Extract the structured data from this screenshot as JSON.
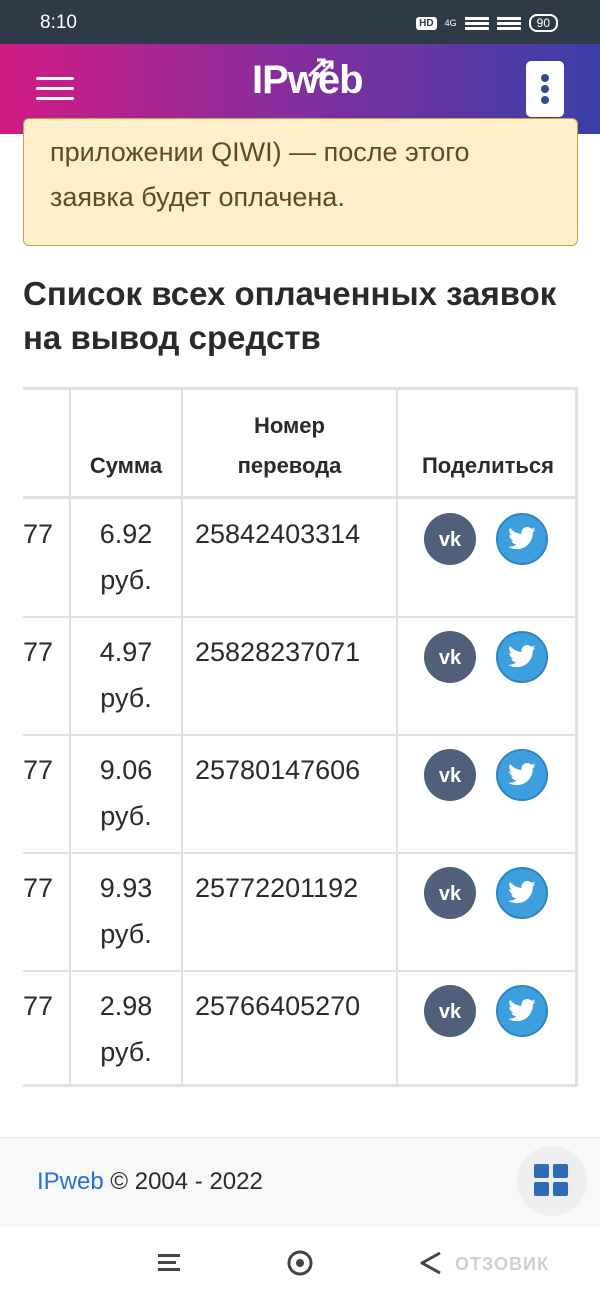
{
  "status_bar": {
    "time": "8:10",
    "hd": "HD",
    "network": "4G",
    "battery": "90"
  },
  "header": {
    "logo": "IPweb",
    "menu_icon": "hamburger-icon",
    "more_icon": "more-vertical-icon",
    "gradient_colors": [
      "#d11b83",
      "#8a2c9d",
      "#3a3fa8"
    ]
  },
  "notice": {
    "line1": "приложении QIWI) — после этого",
    "line2": "заявка будет оплачена."
  },
  "section": {
    "title": "Список всех оплаченных заявок на вывод средств"
  },
  "table": {
    "headers": {
      "sum": "Сумма",
      "number_line1": "Номер",
      "number_line2": "перевода",
      "share": "Поделиться"
    },
    "rows": [
      {
        "first": "77",
        "amount": "6.92",
        "currency": "руб.",
        "transfer": "25842403314"
      },
      {
        "first": "77",
        "amount": "4.97",
        "currency": "руб.",
        "transfer": "25828237071"
      },
      {
        "first": "77",
        "amount": "9.06",
        "currency": "руб.",
        "transfer": "25780147606"
      },
      {
        "first": "77",
        "amount": "9.93",
        "currency": "руб.",
        "transfer": "25772201192"
      },
      {
        "first": "77",
        "amount": "2.98",
        "currency": "руб.",
        "transfer": "25766405270"
      }
    ],
    "share_icons": [
      "vk-icon",
      "twitter-icon"
    ]
  },
  "footer": {
    "brand": "IPweb",
    "copyright": "© 2004 - 2022",
    "grid_icon": "grid-icon"
  },
  "nav": {
    "menu_icon": "recents-icon",
    "home_icon": "home-icon",
    "back_icon": "back-icon"
  },
  "watermark": "ОТЗОВИК"
}
